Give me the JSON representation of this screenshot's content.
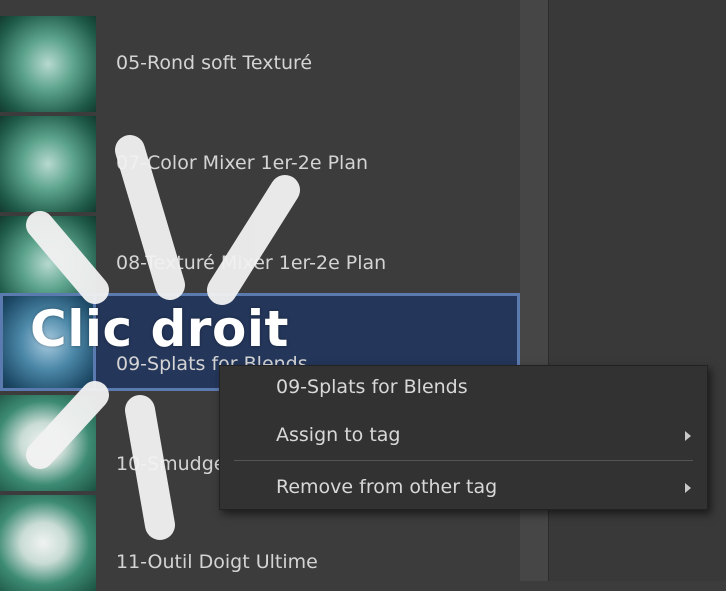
{
  "brush_list": {
    "items": [
      {
        "label": "05-Rond soft Texturé",
        "selected": false
      },
      {
        "label": "07-Color Mixer 1er-2e Plan",
        "selected": false
      },
      {
        "label": "08-Texturé Mixer 1er-2e Plan",
        "selected": false
      },
      {
        "label": "09-Splats for Blends",
        "selected": true
      },
      {
        "label": "10-Smudge",
        "selected": false
      },
      {
        "label": "11-Outil Doigt Ultime",
        "selected": false
      }
    ]
  },
  "context_menu": {
    "title": "09-Splats for Blends",
    "items": [
      {
        "label": "Assign to tag",
        "has_submenu": true,
        "arrow_icon": "chevron-right-icon"
      },
      {
        "label": "Remove from other tag",
        "has_submenu": true,
        "arrow_icon": "chevron-right-icon"
      }
    ]
  },
  "overlay": {
    "text": "Clic droit"
  },
  "colors": {
    "background": "#3c3c3c",
    "selection": "#24365a",
    "selection_border": "#5b7bb0",
    "menu_background": "#323232",
    "text": "#d4d4d4"
  }
}
